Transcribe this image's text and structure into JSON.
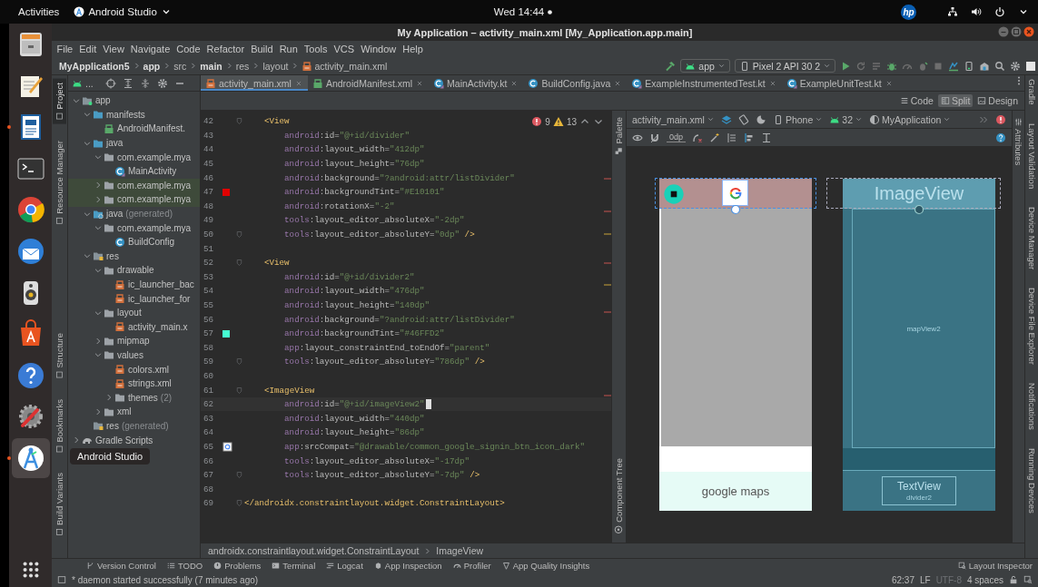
{
  "top_bar": {
    "activities": "Activities",
    "app_menu": "Android Studio",
    "clock": "Wed 14:44",
    "logo": "hp"
  },
  "dock": [
    {
      "kind": "files",
      "running": false,
      "selected": false
    },
    {
      "kind": "text-editor",
      "running": false,
      "selected": false
    },
    {
      "kind": "writer",
      "running": true,
      "selected": false
    },
    {
      "kind": "terminal",
      "running": false,
      "selected": false
    },
    {
      "kind": "browser",
      "running": false,
      "selected": false
    },
    {
      "kind": "mail",
      "running": false,
      "selected": false
    },
    {
      "kind": "music",
      "running": false,
      "selected": false
    },
    {
      "kind": "software",
      "running": false,
      "selected": false
    },
    {
      "kind": "help",
      "running": false,
      "selected": false
    },
    {
      "kind": "tools",
      "running": false,
      "selected": false
    },
    {
      "kind": "android-studio",
      "running": true,
      "selected": true
    }
  ],
  "dock_tooltip": "Android Studio",
  "window": {
    "title": "My Application – activity_main.xml [My_Application.app.main]"
  },
  "menu": [
    "File",
    "Edit",
    "View",
    "Navigate",
    "Code",
    "Refactor",
    "Build",
    "Run",
    "Tools",
    "VCS",
    "Window",
    "Help"
  ],
  "breadcrumb": [
    {
      "label": "MyApplication5",
      "bold": true,
      "kind": "folder"
    },
    {
      "label": "app",
      "bold": true,
      "kind": "folder"
    },
    {
      "label": "src",
      "bold": false,
      "kind": "folder"
    },
    {
      "label": "main",
      "bold": true,
      "kind": "folder"
    },
    {
      "label": "res",
      "bold": false,
      "kind": "folder"
    },
    {
      "label": "layout",
      "bold": false,
      "kind": "folder"
    },
    {
      "label": "activity_main.xml",
      "bold": false,
      "kind": "xml"
    }
  ],
  "run_toolbar": {
    "configuration": "app",
    "device": "Pixel 2 API 30 2"
  },
  "left_strip": {
    "top": [
      {
        "label": "Project",
        "selected": true
      },
      {
        "label": "Resource Manager",
        "selected": false
      }
    ],
    "bottom": [
      {
        "label": "Structure",
        "selected": false
      },
      {
        "label": "Bookmarks",
        "selected": false
      },
      {
        "label": "Build Variants",
        "selected": false
      }
    ]
  },
  "project": {
    "view_label": "...",
    "tree": [
      {
        "label": "app",
        "kind": "module",
        "expanded": true,
        "highlighted": false,
        "children": [
          {
            "label": "manifests",
            "kind": "folder",
            "expanded": true,
            "highlighted": false,
            "children": [
              {
                "label": "AndroidManifest.",
                "kind": "manifest",
                "highlighted": false
              }
            ]
          },
          {
            "label": "java",
            "kind": "folder",
            "expanded": true,
            "highlighted": false,
            "children": [
              {
                "label": "com.example.mya",
                "kind": "package",
                "expanded": true,
                "highlighted": false,
                "children": [
                  {
                    "label": "MainActivity",
                    "kind": "kotlin",
                    "highlighted": false
                  }
                ]
              },
              {
                "label": "com.example.mya",
                "kind": "package",
                "expanded": false,
                "highlighted": true
              },
              {
                "label": "com.example.mya",
                "kind": "package",
                "expanded": false,
                "highlighted": true
              }
            ]
          },
          {
            "label": "java",
            "suffix": "(generated)",
            "kind": "generated",
            "expanded": true,
            "highlighted": false,
            "children": [
              {
                "label": "com.example.mya",
                "kind": "package",
                "expanded": true,
                "highlighted": false,
                "children": [
                  {
                    "label": "BuildConfig",
                    "kind": "java",
                    "highlighted": false
                  }
                ]
              }
            ]
          },
          {
            "label": "res",
            "kind": "res",
            "expanded": true,
            "highlighted": false,
            "children": [
              {
                "label": "drawable",
                "kind": "package",
                "expanded": true,
                "highlighted": false,
                "children": [
                  {
                    "label": "ic_launcher_bac",
                    "kind": "xml",
                    "highlighted": false
                  },
                  {
                    "label": "ic_launcher_for",
                    "kind": "xml",
                    "highlighted": false
                  }
                ]
              },
              {
                "label": "layout",
                "kind": "package",
                "expanded": true,
                "highlighted": false,
                "children": [
                  {
                    "label": "activity_main.x",
                    "kind": "xml",
                    "highlighted": false
                  }
                ]
              },
              {
                "label": "mipmap",
                "kind": "package",
                "expanded": false,
                "highlighted": false
              },
              {
                "label": "values",
                "kind": "package",
                "expanded": true,
                "highlighted": false,
                "children": [
                  {
                    "label": "colors.xml",
                    "kind": "xml",
                    "highlighted": false
                  },
                  {
                    "label": "strings.xml",
                    "kind": "xml",
                    "highlighted": false
                  },
                  {
                    "label": "themes",
                    "suffix": "(2)",
                    "kind": "package",
                    "expanded": false,
                    "highlighted": false
                  }
                ]
              },
              {
                "label": "xml",
                "kind": "package",
                "expanded": false,
                "highlighted": false
              }
            ]
          },
          {
            "label": "res",
            "suffix": "(generated)",
            "kind": "res",
            "highlighted": false
          }
        ]
      },
      {
        "label": "Gradle Scripts",
        "kind": "gradle",
        "expanded": false,
        "highlighted": false
      }
    ]
  },
  "editor_tabs": [
    {
      "label": "activity_main.xml",
      "kind": "xml",
      "selected": true
    },
    {
      "label": "AndroidManifest.xml",
      "kind": "manifest",
      "selected": false
    },
    {
      "label": "MainActivity.kt",
      "kind": "kotlin",
      "selected": false
    },
    {
      "label": "BuildConfig.java",
      "kind": "java",
      "selected": false
    },
    {
      "label": "ExampleInstrumentedTest.kt",
      "kind": "kotlin",
      "selected": false
    },
    {
      "label": "ExampleUnitTest.kt",
      "kind": "kotlin",
      "selected": false
    }
  ],
  "view_modes": [
    {
      "label": "Code",
      "kind": "code",
      "selected": false
    },
    {
      "label": "Split",
      "kind": "split",
      "selected": true
    },
    {
      "label": "Design",
      "kind": "design",
      "selected": false
    }
  ],
  "code": {
    "inspection": {
      "errors": "9",
      "warnings": "13"
    },
    "lines": [
      {
        "number": "42",
        "text": "    <View",
        "fold": true,
        "current": false
      },
      {
        "number": "43",
        "text": "        android:id=\"@+id/divider\"",
        "fold": false,
        "current": false
      },
      {
        "number": "44",
        "text": "        android:layout_width=\"412dp\"",
        "fold": false,
        "current": false
      },
      {
        "number": "45",
        "text": "        android:layout_height=\"76dp\"",
        "fold": false,
        "current": false
      },
      {
        "number": "46",
        "text": "        android:background=\"?android:attr/listDivider\"",
        "fold": false,
        "current": false
      },
      {
        "number": "47",
        "text": "        android:backgroundTint=\"#E10101\"",
        "fold": false,
        "current": false,
        "gutter": {
          "kind": "swatch",
          "color": "#e10101"
        }
      },
      {
        "number": "48",
        "text": "        android:rotationX=\"-2\"",
        "fold": false,
        "current": false
      },
      {
        "number": "49",
        "text": "        tools:layout_editor_absoluteX=\"-2dp\"",
        "fold": false,
        "current": false
      },
      {
        "number": "50",
        "text": "        tools:layout_editor_absoluteY=\"0dp\" />",
        "fold": true,
        "current": false
      },
      {
        "number": "51",
        "fold": false,
        "current": false
      },
      {
        "number": "52",
        "text": "    <View",
        "fold": true,
        "current": false
      },
      {
        "number": "53",
        "text": "        android:id=\"@+id/divider2\"",
        "fold": false,
        "current": false
      },
      {
        "number": "54",
        "text": "        android:layout_width=\"476dp\"",
        "fold": false,
        "current": false
      },
      {
        "number": "55",
        "text": "        android:layout_height=\"140dp\"",
        "fold": false,
        "current": false
      },
      {
        "number": "56",
        "text": "        android:background=\"?android:attr/listDivider\"",
        "fold": false,
        "current": false
      },
      {
        "number": "57",
        "text": "        android:backgroundTint=\"#46FFD2\"",
        "fold": false,
        "current": false,
        "gutter": {
          "kind": "swatch",
          "color": "#46ffd2"
        }
      },
      {
        "number": "58",
        "text": "        app:layout_constraintEnd_toEndOf=\"parent\"",
        "fold": false,
        "current": false
      },
      {
        "number": "59",
        "text": "        tools:layout_editor_absoluteY=\"786dp\" />",
        "fold": true,
        "current": false
      },
      {
        "number": "60",
        "fold": false,
        "current": false
      },
      {
        "number": "61",
        "text": "    <ImageView",
        "fold": true,
        "current": false
      },
      {
        "number": "62",
        "text": "        android:id=\"@+id/imageView2\"",
        "fold": false,
        "current": true
      },
      {
        "number": "63",
        "text": "        android:layout_width=\"440dp\"",
        "fold": false,
        "current": false
      },
      {
        "number": "64",
        "text": "        android:layout_height=\"86dp\"",
        "fold": false,
        "current": false
      },
      {
        "number": "65",
        "text": "        app:srcCompat=\"@drawable/common_google_signin_btn_icon_dark\"",
        "fold": false,
        "current": false,
        "gutter": {
          "kind": "image"
        }
      },
      {
        "number": "66",
        "text": "        tools:layout_editor_absoluteX=\"-17dp\"",
        "fold": false,
        "current": false
      },
      {
        "number": "67",
        "text": "        tools:layout_editor_absoluteY=\"-7dp\" />",
        "fold": true,
        "current": false
      },
      {
        "number": "68",
        "fold": false,
        "current": false
      },
      {
        "number": "69",
        "text": "</androidx.constraintlayout.widget.ConstraintLayout>",
        "fold": true,
        "current": false
      }
    ]
  },
  "design": {
    "strip": [
      {
        "label": "Palette",
        "selected": false
      },
      {
        "label": "Component Tree",
        "selected": false
      }
    ],
    "toolbar": {
      "file": "activity_main.xml",
      "device": "Phone",
      "api": "32",
      "theme": "MyApplication",
      "margin": "0dp"
    },
    "preview": {
      "text": "google maps"
    },
    "blueprint": {
      "image_label": "ImageView",
      "map_label": "mapView2",
      "text_label": "TextView",
      "divider_label": "divider2"
    }
  },
  "attributes_strip": [
    {
      "label": "Attributes",
      "selected": false
    }
  ],
  "right_strip": [
    {
      "label": "Gradle",
      "selected": false
    },
    {
      "label": "Layout Validation",
      "selected": false
    },
    {
      "label": "Device Manager",
      "selected": false
    },
    {
      "label": "Device File Explorer",
      "selected": false
    },
    {
      "label": "Notifications",
      "selected": false
    },
    {
      "label": "Running Devices",
      "selected": false
    }
  ],
  "editor_breadcrumb": [
    "androidx.constraintlayout.widget.ConstraintLayout",
    "ImageView"
  ],
  "tool_windows": [
    {
      "label": "Version Control",
      "kind": "vcs"
    },
    {
      "label": "TODO",
      "kind": "todo"
    },
    {
      "label": "Problems",
      "kind": "problems"
    },
    {
      "label": "Terminal",
      "kind": "terminal"
    },
    {
      "label": "Logcat",
      "kind": "logcat"
    },
    {
      "label": "App Inspection",
      "kind": "inspection"
    },
    {
      "label": "Profiler",
      "kind": "profiler"
    },
    {
      "label": "App Quality Insights",
      "kind": "quality"
    }
  ],
  "layout_inspector": "Layout Inspector",
  "status": {
    "message": "* daemon started successfully (7 minutes ago)",
    "items": [
      {
        "label": "62:37",
        "disabled": false
      },
      {
        "label": "LF",
        "disabled": false
      },
      {
        "label": "UTF-8",
        "disabled": true
      },
      {
        "label": "4 spaces",
        "disabled": false
      }
    ]
  }
}
